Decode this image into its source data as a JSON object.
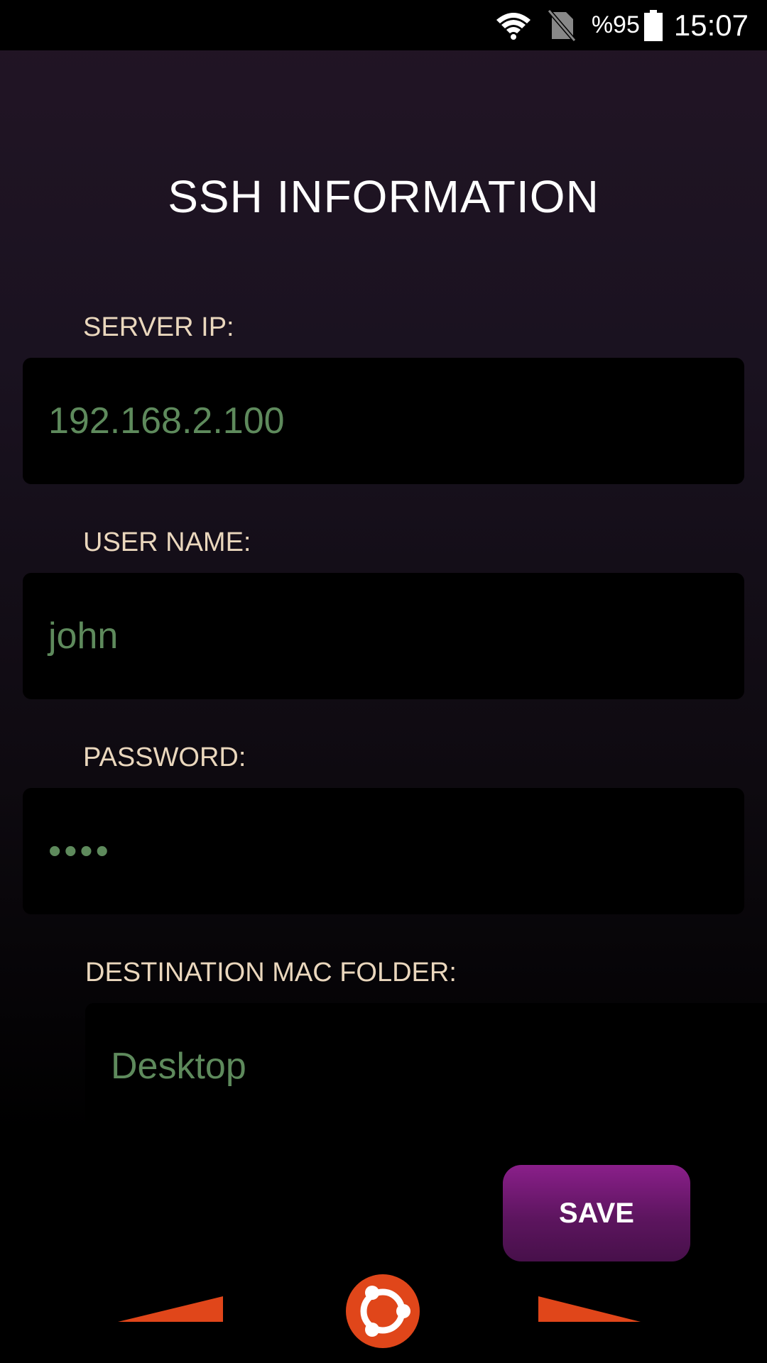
{
  "status_bar": {
    "battery_percent": "%95",
    "time": "15:07",
    "icons": [
      "wifi-icon",
      "no-sim-icon",
      "battery-icon"
    ]
  },
  "page": {
    "title": "SSH INFORMATION"
  },
  "fields": {
    "server_ip": {
      "label": "SERVER IP:",
      "value": "192.168.2.100"
    },
    "user_name": {
      "label": "USER NAME:",
      "value": "john"
    },
    "password": {
      "label": "PASSWORD:",
      "value": "••••"
    },
    "destination_folder": {
      "label": "DESTINATION MAC FOLDER:",
      "value": "Desktop"
    }
  },
  "actions": {
    "save_label": "SAVE"
  },
  "nav": {
    "icons": [
      "back-arrow-icon",
      "ubuntu-logo-icon",
      "forward-arrow-icon"
    ]
  },
  "colors": {
    "label": "#ead7bd",
    "value": "#5e8a5c",
    "accent_orange": "#e0461a",
    "save_button": "#5d155f"
  }
}
